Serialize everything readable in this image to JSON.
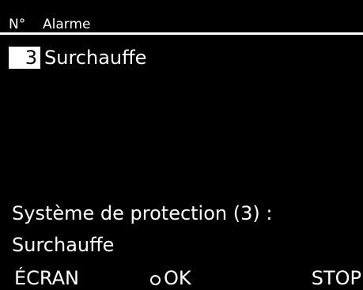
{
  "header": {
    "number_label": "N°",
    "title": "Alarme"
  },
  "alarm": {
    "number": "3",
    "name": "Surchauffe"
  },
  "details": {
    "line1": "Système de protection (3) :",
    "line2": "Surchauffe"
  },
  "softkeys": {
    "left": "ÉCRAN",
    "middle": "OK",
    "right": "STOP"
  },
  "icons": {
    "ok": "circle-icon"
  },
  "colors": {
    "background": "#000000",
    "foreground": "#ffffff",
    "highlight_text": "#000000"
  }
}
